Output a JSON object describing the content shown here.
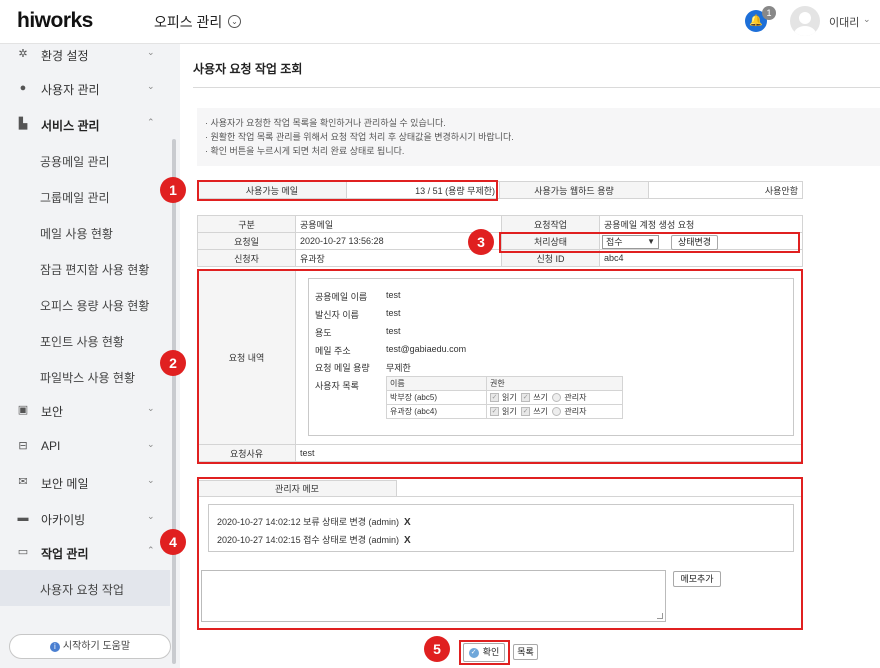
{
  "topbar": {
    "logo": "hiworks",
    "app": "오피스 관리",
    "badge": "1",
    "user": "이대리"
  },
  "sidebar": {
    "items": [
      {
        "label": "환경 설정",
        "icon": "gear-icon"
      },
      {
        "label": "사용자 관리",
        "icon": "user-icon"
      },
      {
        "label": "서비스 관리",
        "icon": "chart-icon"
      },
      {
        "label": "공용메일 관리"
      },
      {
        "label": "그룹메일 관리"
      },
      {
        "label": "메일 사용 현황"
      },
      {
        "label": "잠금 편지함 사용 현황"
      },
      {
        "label": "오피스 용량 사용 현황"
      },
      {
        "label": "포인트 사용 현황"
      },
      {
        "label": "파일박스 사용 현황"
      },
      {
        "label": "보안",
        "icon": "lock-icon"
      },
      {
        "label": "API",
        "icon": "api-icon"
      },
      {
        "label": "보안 메일",
        "icon": "mail-icon"
      },
      {
        "label": "아카이빙",
        "icon": "archive-icon"
      },
      {
        "label": "작업 관리",
        "icon": "monitor-icon"
      },
      {
        "label": "사용자 요청 작업"
      }
    ],
    "help": "시작하기 도움말"
  },
  "page": {
    "title": "사용자 요청 작업 조회",
    "notice": [
      "· 사용자가 요청한 작업 목록을 확인하거나 관리하실 수 있습니다.",
      "· 원활한 작업 목록 관리를 위해서 요청 작업 처리 후 상태값을 변경하시기 바랍니다.",
      "· 확인 버튼을 누르시게 되면 처리 완료 상태로 됩니다."
    ]
  },
  "usage": {
    "mail_label": "사용가능 메일",
    "mail_value": "13 / 51 (용량 무제한)",
    "webhard_label": "사용가능 웹하드 용량",
    "webhard_value": "사용안함"
  },
  "info": {
    "type_label": "구분",
    "type_value": "공용메일",
    "job_label": "요청작업",
    "job_value": "공용메일 계정 생성 요청",
    "date_label": "요청일",
    "date_value": "2020-10-27 13:56:28",
    "status_label": "처리상태",
    "status_value": "접수",
    "status_button": "상태변경",
    "requester_label": "신청자",
    "requester_value": "유과장",
    "id_label": "신청 ID",
    "id_value": "abc4"
  },
  "request": {
    "label": "요청 내역",
    "rows": [
      {
        "k": "공용메일 이름",
        "v": "test"
      },
      {
        "k": "발신자 이름",
        "v": "test"
      },
      {
        "k": "용도",
        "v": "test"
      },
      {
        "k": "메일 주소",
        "v": "test@gabiaedu.com"
      },
      {
        "k": "요청 메일 용량",
        "v": "무제한"
      }
    ],
    "users_label": "사용자 목록",
    "perm_headers": [
      "이름",
      "권한"
    ],
    "perm_rows": [
      {
        "name": "박부장 (abc5)",
        "read": "읽기",
        "write": "쓰기",
        "admin": "관리자"
      },
      {
        "name": "유과장 (abc4)",
        "read": "읽기",
        "write": "쓰기",
        "admin": "관리자"
      }
    ],
    "reason_label": "요청사유",
    "reason_value": "test"
  },
  "memo": {
    "tab": "관리자 메모",
    "entries": [
      {
        "text": "2020-10-27 14:02:12  보류 상태로 변경  (admin)",
        "x": "X"
      },
      {
        "text": "2020-10-27 14:02:15  접수 상태로 변경  (admin)",
        "x": "X"
      }
    ],
    "add_button": "메모추가"
  },
  "footer": {
    "ok": "확인",
    "list": "목록"
  },
  "markers": [
    "1",
    "2",
    "3",
    "4",
    "5"
  ],
  "colors": {
    "accent": "#e02020",
    "bell": "#1d6fd8"
  }
}
